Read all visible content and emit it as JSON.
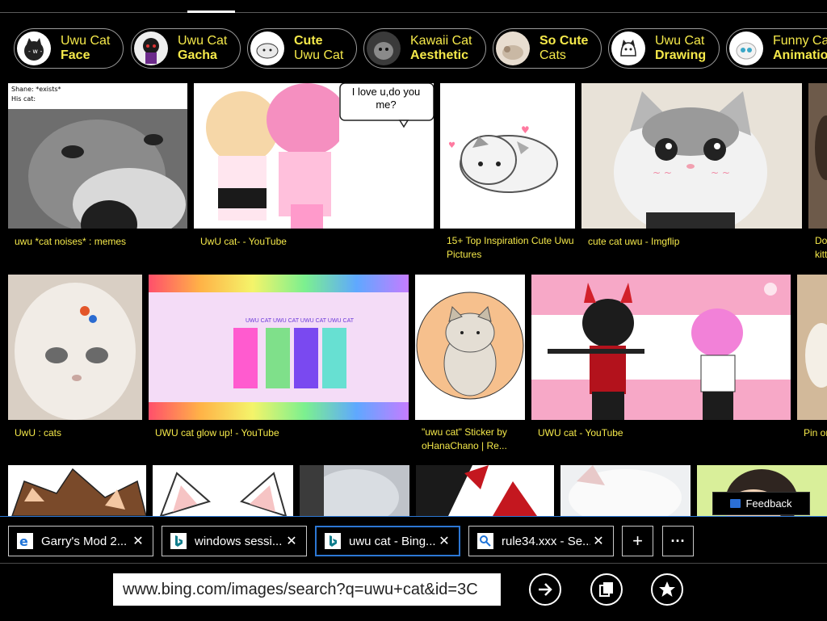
{
  "suggestions": [
    {
      "line1": "Uwu Cat",
      "line2": "Face",
      "bold": "line2"
    },
    {
      "line1": "Uwu Cat",
      "line2": "Gacha",
      "bold": "line2"
    },
    {
      "line1": "Cute",
      "line2": "Uwu Cat",
      "bold": "line1"
    },
    {
      "line1": "Kawaii Cat",
      "line2": "Aesthetic",
      "bold": "line2"
    },
    {
      "line1": "So Cute",
      "line2": "Cats",
      "bold": "line1"
    },
    {
      "line1": "Uwu Cat",
      "line2": "Drawing",
      "bold": "line2"
    },
    {
      "line1": "Funny Cat",
      "line2": "Animation",
      "bold": "line2"
    }
  ],
  "results_row1": [
    {
      "caption": "uwu *cat noises* : memes",
      "overlay": "Shane: *exists*\nHis cat:"
    },
    {
      "caption": "UwU cat- - YouTube",
      "bubble": "I love u,do you me?"
    },
    {
      "caption": "15+ Top Inspiration Cute Uwu Pictures"
    },
    {
      "caption": "cute cat uwu - Imgflip"
    },
    {
      "caption": "Do kitt"
    }
  ],
  "results_row2": [
    {
      "caption": "UwU : cats"
    },
    {
      "caption": "UWU cat glow up! - YouTube",
      "banner": "UWU CAT UWU CAT UWU CAT UWU CAT"
    },
    {
      "caption": "\"uwu cat\" Sticker by oHanaChano | Re..."
    },
    {
      "caption": "UWU cat - YouTube"
    },
    {
      "caption": "Pin on"
    }
  ],
  "feedback_label": "Feedback",
  "tabs": [
    {
      "label": "Garry's Mod 2...",
      "icon": "ie-icon",
      "active": false
    },
    {
      "label": "windows sessi...",
      "icon": "bing-icon",
      "active": false
    },
    {
      "label": "uwu cat - Bing...",
      "icon": "bing-icon",
      "active": true
    },
    {
      "label": "rule34.xxx - Se...",
      "icon": "page-icon",
      "active": false
    }
  ],
  "tab_close_glyph": "✕",
  "new_tab_glyph": "+",
  "more_glyph": "···",
  "address": {
    "url": "www.bing.com/images/search?q=uwu+cat&id=3C"
  },
  "colors": {
    "caption": "#f5e94a",
    "accent": "#2c77d4",
    "background": "#000000"
  }
}
